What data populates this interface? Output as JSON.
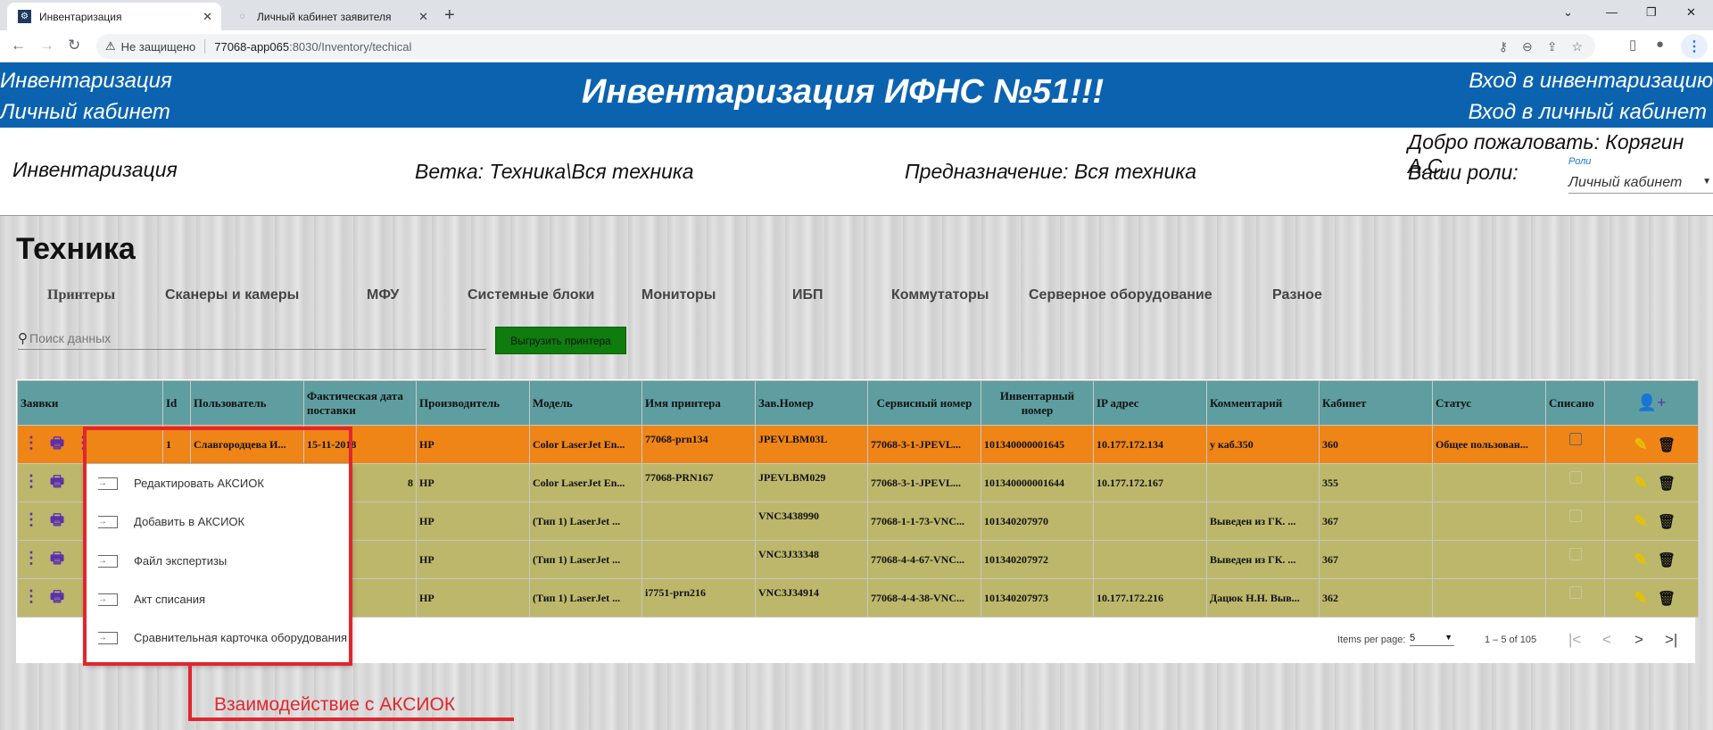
{
  "browser": {
    "tabs": [
      {
        "label": "Инвентаризация"
      },
      {
        "label": "Личный кабинет заявителя"
      }
    ],
    "address": {
      "security": "Не защищено",
      "url_host": "77068-app065",
      "url_rest": ":8030/Inventory/techical"
    }
  },
  "header": {
    "left1": "Инвентаризация",
    "left2": "Личный кабинет",
    "title": "Инвентаризация ИФНС №51!!!",
    "right1": "Вход в инвентаризацию",
    "right2": "Вход в личный кабинет"
  },
  "info": {
    "section": "Инвентаризация",
    "branch": "Ветка: Техника\\Вся техника",
    "purpose": "Предназначение: Вся техника",
    "welcome": "Добро пожаловать: Корягин А.С.",
    "roles_label": "Ваши роли:",
    "roles_field_label": "Роли",
    "roles_value": "Личный кабинет"
  },
  "page": {
    "title": "Техника",
    "categories": [
      "Принтеры",
      "Сканеры и камеры",
      "МФУ",
      "Системные блоки",
      "Мониторы",
      "ИБП",
      "Коммутаторы",
      "Серверное оборудование",
      "Разное"
    ],
    "search_placeholder": "Поиск данных",
    "export_label": "Выгрузить принтера"
  },
  "table": {
    "headers": {
      "requests": "Заявки",
      "id": "Id",
      "user": "Пользователь",
      "date": "Фактическая дата поставки",
      "maker": "Производитель",
      "model": "Модель",
      "printer_name": "Имя принтера",
      "serial": "Зав.Номер",
      "service": "Сервисный номер",
      "inventory": "Инвентарный номер",
      "ip": "IP адрес",
      "comment": "Комментарий",
      "cabinet": "Кабинет",
      "status": "Статус",
      "written_off": "Списано"
    },
    "rows": [
      {
        "id": "1",
        "user": "Славгородцева И...",
        "date": "15-11-2018",
        "maker": "HP",
        "model": "Color LaserJet En...",
        "printer_name": "77068-prn134",
        "serial": "JPEVLBM03L",
        "service": "77068-3-1-JPEVL...",
        "inventory": "101340000001645",
        "ip": "10.177.172.134",
        "comment": "у каб.350",
        "cabinet": "360",
        "status": "Общее пользован..."
      },
      {
        "id": "",
        "user": "",
        "date": "8",
        "maker": "HP",
        "model": "Color LaserJet En...",
        "printer_name": "77068-PRN167",
        "serial": "JPEVLBM029",
        "service": "77068-3-1-JPEVL...",
        "inventory": "101340000001644",
        "ip": "10.177.172.167",
        "comment": "",
        "cabinet": "355",
        "status": ""
      },
      {
        "id": "",
        "user": "",
        "date": "",
        "maker": "HP",
        "model": "(Тип 1) LaserJet ...",
        "printer_name": "",
        "serial": "VNC3438990",
        "service": "77068-1-1-73-VNC...",
        "inventory": "101340207970",
        "ip": "",
        "comment": "Выведен из ГК. ...",
        "cabinet": "367",
        "status": ""
      },
      {
        "id": "",
        "user": "",
        "date": "",
        "maker": "HP",
        "model": "(Тип 1) LaserJet ...",
        "printer_name": "",
        "serial": "VNC3J33348",
        "service": "77068-4-4-67-VNC...",
        "inventory": "101340207972",
        "ip": "",
        "comment": "Выведен из ГК. ...",
        "cabinet": "367",
        "status": ""
      },
      {
        "id": "",
        "user": "",
        "date": "",
        "maker": "HP",
        "model": "(Тип 1) LaserJet ...",
        "printer_name": "i7751-prn216",
        "serial": "VNC3J34914",
        "service": "77068-4-4-38-VNC...",
        "inventory": "101340207973",
        "ip": "10.177.172.216",
        "comment": "Дацюк Н.Н. Выв...",
        "cabinet": "362",
        "status": ""
      }
    ]
  },
  "pagination": {
    "items_label": "Items per page:",
    "page_size": "5",
    "range": "1 – 5 of 105"
  },
  "menu": {
    "items": [
      "Редактировать АКСИОК",
      "Добавить в АКСИОК",
      "Файл экспертизы",
      "Акт списания",
      "Сравнительная карточка оборудования"
    ]
  },
  "annotation": {
    "text": "Взаимодействие с АКСИОК",
    "color": "#e1262e"
  },
  "colors": {
    "header_blue": "#0b63b0",
    "table_head": "#5f9ea0",
    "row_selected": "#ef8417",
    "row": "#bdb76b",
    "export_button": "#0e7d0e"
  }
}
